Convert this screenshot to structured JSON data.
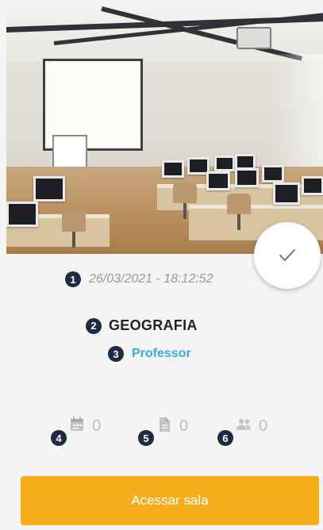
{
  "card": {
    "image_description": "classroom-photo",
    "date_time": "26/03/2021 - 18:12:52",
    "subject": "GEOGRAFIA",
    "role": "Professor",
    "stats": [
      {
        "icon": "calendar-icon",
        "count": "0",
        "marker": "4"
      },
      {
        "icon": "document-icon",
        "count": "0",
        "marker": "5"
      },
      {
        "icon": "people-icon",
        "count": "0",
        "marker": "6"
      }
    ],
    "markers": {
      "date": "1",
      "subject": "2",
      "role": "3"
    },
    "access_button_label": "Acessar sala"
  },
  "colors": {
    "accent": "#f5ad1b",
    "role_text": "#3cb0cc",
    "marker_bg": "#1f2a44",
    "muted_text": "#9a9a9a"
  }
}
